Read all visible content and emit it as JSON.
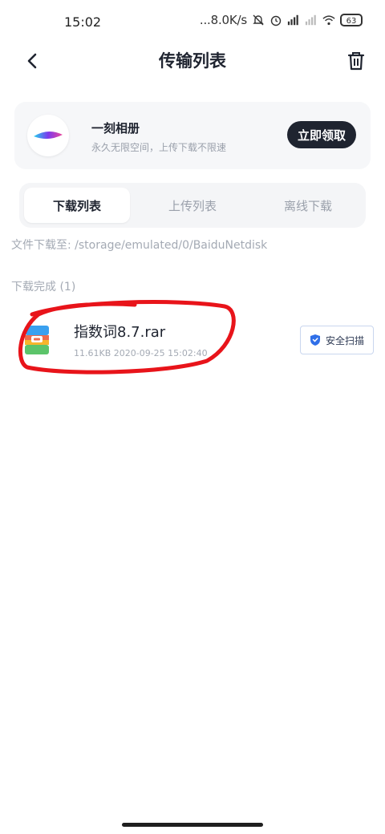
{
  "status_bar": {
    "time": "15:02",
    "net_speed": "...8.0K/s",
    "battery": "63"
  },
  "header": {
    "title": "传输列表"
  },
  "promo": {
    "title": "一刻相册",
    "subtitle": "永久无限空间，上传下载不限速",
    "button": "立即领取"
  },
  "tabs": [
    {
      "label": "下载列表",
      "active": true
    },
    {
      "label": "上传列表",
      "active": false
    },
    {
      "label": "离线下载",
      "active": false
    }
  ],
  "download_path": "文件下载至: /storage/emulated/0/BaiduNetdisk",
  "section_label": "下载完成 (1)",
  "files": [
    {
      "name": "指数词8.7.rar",
      "meta": "11.61KB 2020-09-25 15:02:40",
      "action": "安全扫描"
    }
  ],
  "colors": {
    "primary_dark": "#1f2430",
    "muted": "#a4aab4",
    "annotation_red": "#e8141a"
  }
}
